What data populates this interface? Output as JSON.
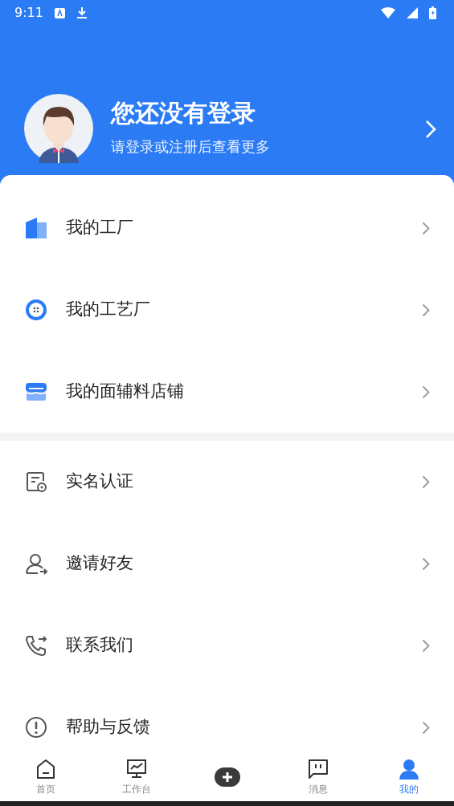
{
  "status_bar": {
    "time": "9:11"
  },
  "profile": {
    "title": "您还没有登录",
    "subtitle": "请登录或注册后查看更多"
  },
  "menu_groups": [
    {
      "items": [
        {
          "label": "我的工厂"
        },
        {
          "label": "我的工艺厂"
        },
        {
          "label": "我的面辅料店铺"
        }
      ]
    },
    {
      "items": [
        {
          "label": "实名认证"
        },
        {
          "label": "邀请好友"
        },
        {
          "label": "联系我们"
        },
        {
          "label": "帮助与反馈"
        }
      ]
    }
  ],
  "tab_bar": [
    {
      "kind": "tab",
      "label": "首页",
      "selected": false
    },
    {
      "kind": "tab",
      "label": "工作台",
      "selected": false
    },
    {
      "kind": "add"
    },
    {
      "kind": "tab",
      "label": "消息",
      "selected": false
    },
    {
      "kind": "tab",
      "label": "我的",
      "selected": true
    }
  ]
}
